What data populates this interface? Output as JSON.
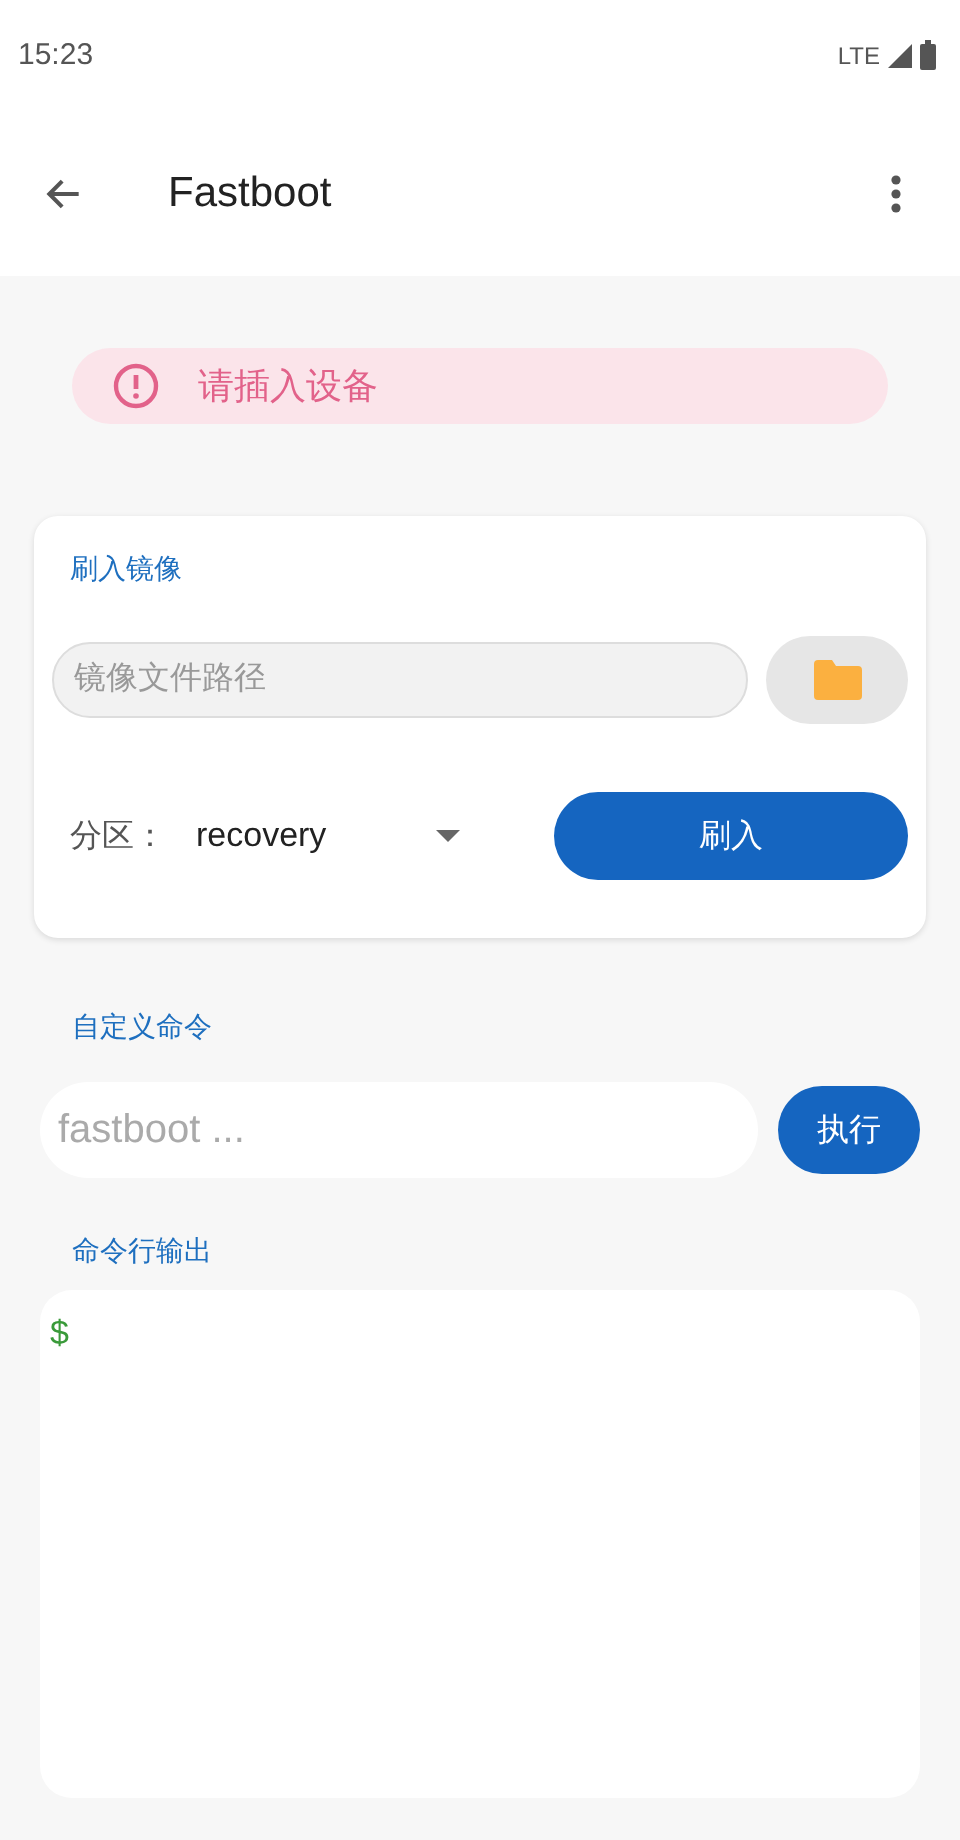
{
  "status_bar": {
    "time": "15:23",
    "network": "LTE"
  },
  "app_bar": {
    "title": "Fastboot"
  },
  "alert": {
    "text": "请插入设备"
  },
  "flash_card": {
    "title": "刷入镜像",
    "path_placeholder": "镜像文件路径",
    "partition_label": "分区：",
    "partition_value": "recovery",
    "flash_button": "刷入"
  },
  "custom_command": {
    "title": "自定义命令",
    "placeholder": "fastboot ...",
    "run_button": "执行"
  },
  "output": {
    "title": "命令行输出",
    "prompt": "$"
  }
}
